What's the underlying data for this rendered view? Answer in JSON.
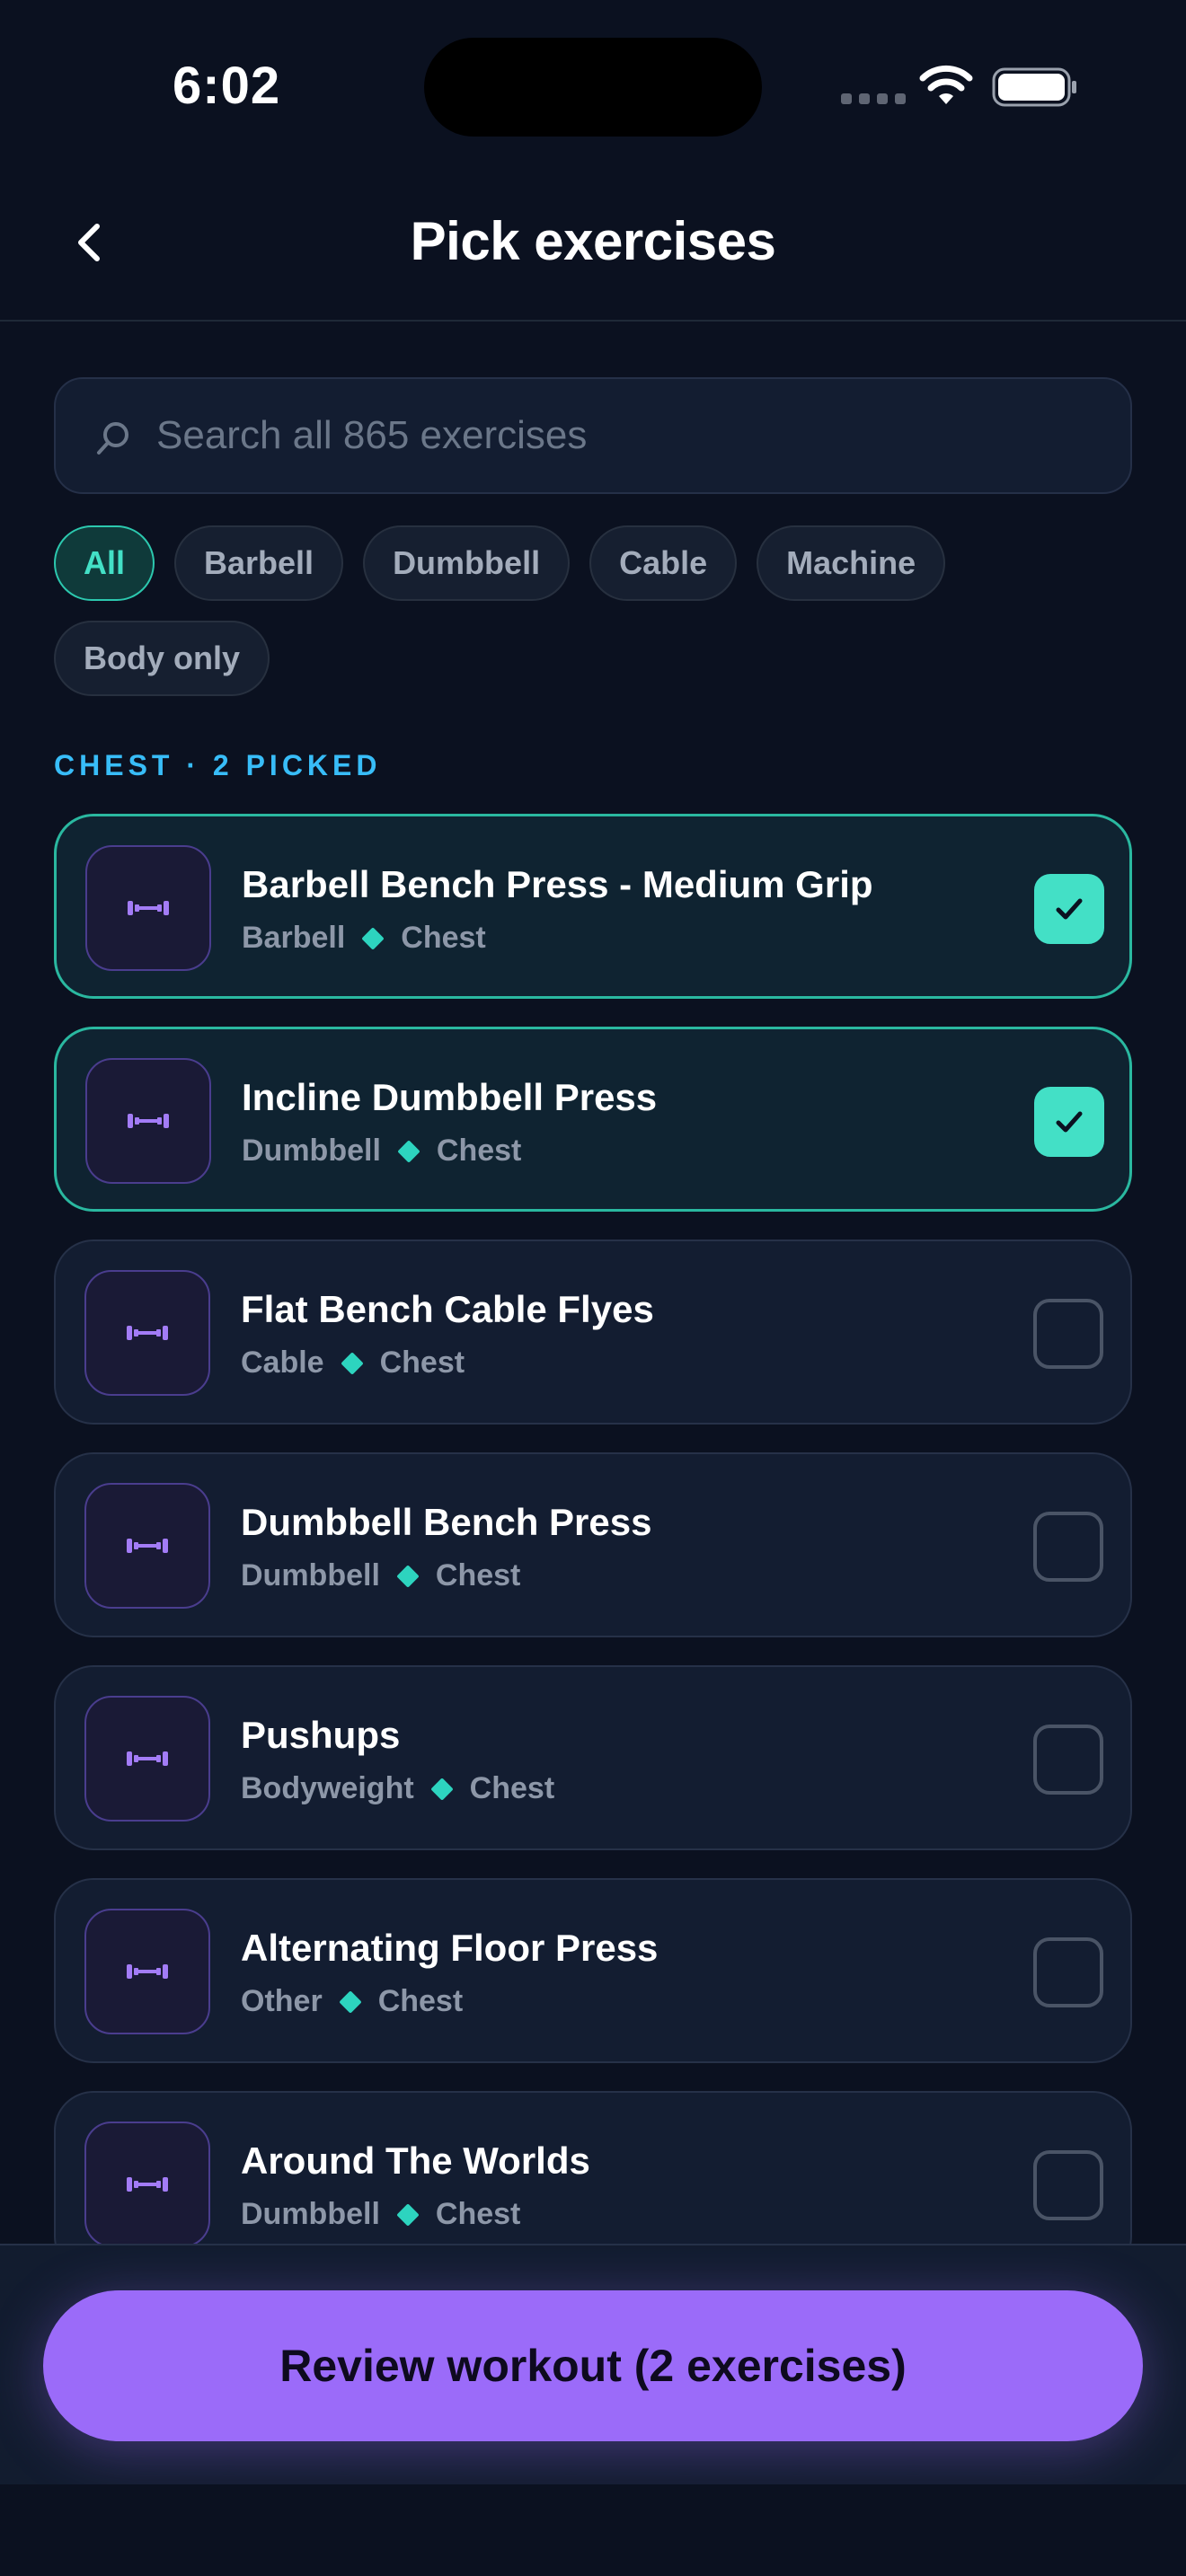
{
  "status_bar": {
    "time": "6:02"
  },
  "header": {
    "title": "Pick exercises",
    "back_icon": "chevron-left-icon"
  },
  "search": {
    "placeholder": "Search all 865 exercises",
    "value": ""
  },
  "filters": [
    {
      "label": "All",
      "active": true
    },
    {
      "label": "Barbell",
      "active": false
    },
    {
      "label": "Dumbbell",
      "active": false
    },
    {
      "label": "Cable",
      "active": false
    },
    {
      "label": "Machine",
      "active": false
    },
    {
      "label": "Body only",
      "active": false
    }
  ],
  "section": {
    "label": "CHEST · 2 PICKED"
  },
  "exercises": [
    {
      "name": "Barbell Bench Press - Medium Grip",
      "equipment": "Barbell",
      "muscle": "Chest",
      "selected": true
    },
    {
      "name": "Incline Dumbbell Press",
      "equipment": "Dumbbell",
      "muscle": "Chest",
      "selected": true
    },
    {
      "name": "Flat Bench Cable Flyes",
      "equipment": "Cable",
      "muscle": "Chest",
      "selected": false
    },
    {
      "name": "Dumbbell Bench Press",
      "equipment": "Dumbbell",
      "muscle": "Chest",
      "selected": false
    },
    {
      "name": "Pushups",
      "equipment": "Bodyweight",
      "muscle": "Chest",
      "selected": false
    },
    {
      "name": "Alternating Floor Press",
      "equipment": "Other",
      "muscle": "Chest",
      "selected": false
    },
    {
      "name": "Around The Worlds",
      "equipment": "Dumbbell",
      "muscle": "Chest",
      "selected": false
    }
  ],
  "cta": {
    "label": "Review workout (2 exercises)"
  },
  "colors": {
    "accent": "#43e0c6",
    "primary": "#9b6bf9",
    "background": "#0b1120",
    "section": "#38bdf8"
  }
}
